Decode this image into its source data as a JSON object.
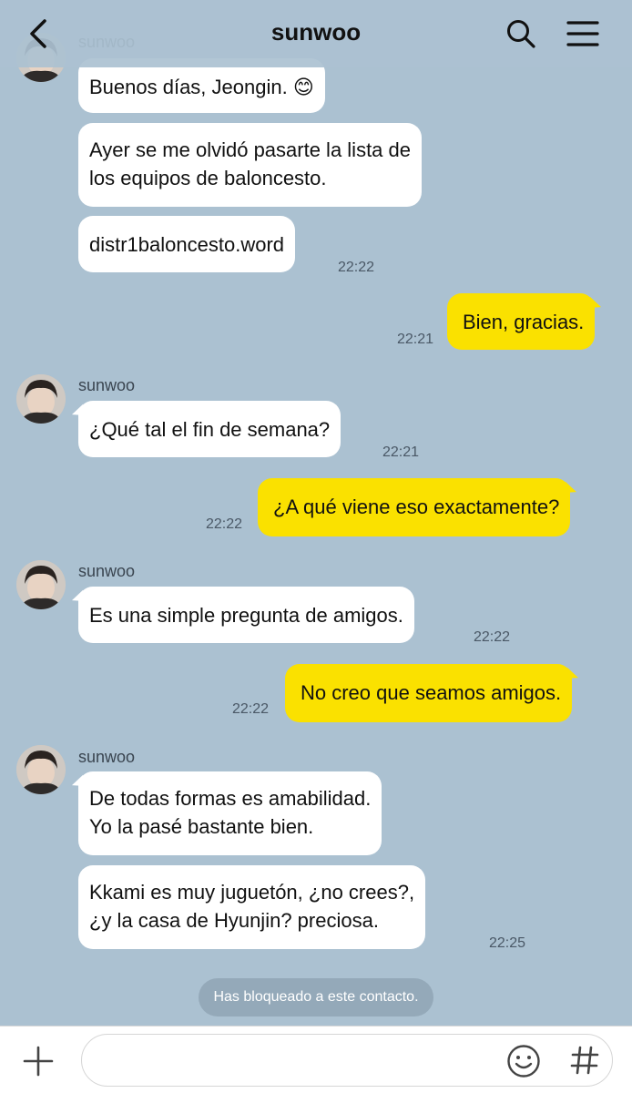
{
  "header": {
    "title": "sunwoo"
  },
  "messages": [
    {
      "from": "them",
      "text": "Buenos días, Jeongin. 😊"
    },
    {
      "from": "them",
      "text": "Ayer se me olvidó pasarte la lista de\nlos equipos de baloncesto."
    },
    {
      "from": "them",
      "text": "distr1baloncesto.word",
      "time": "22:22"
    },
    {
      "from": "me",
      "text": "Bien, gracias.",
      "time": "22:21"
    },
    {
      "from": "them",
      "sender": "sunwoo",
      "text": "¿Qué tal el fin de semana?",
      "time": "22:21"
    },
    {
      "from": "me",
      "text": "¿A qué viene eso exactamente?",
      "time": "22:22"
    },
    {
      "from": "them",
      "sender": "sunwoo",
      "text": "Es una simple pregunta de amigos.",
      "time": "22:22"
    },
    {
      "from": "me",
      "text": "No creo que seamos amigos.",
      "time": "22:22"
    },
    {
      "from": "them",
      "sender": "sunwoo",
      "text": "De todas formas es amabilidad.\nYo la pasé bastante bien."
    },
    {
      "from": "them",
      "text": "Kkami es muy juguetón, ¿no crees?,\n¿y la casa de Hyunjin? preciosa.",
      "time": "22:25"
    }
  ],
  "top_sender": "sunwoo",
  "notice": "Has bloqueado a este contacto.",
  "composer": {
    "placeholder": ""
  },
  "colors": {
    "background": "#abc1d1",
    "incoming_bubble": "#ffffff",
    "outgoing_bubble": "#fae100"
  },
  "icons": [
    "back-arrow-icon",
    "search-icon",
    "menu-icon",
    "plus-icon",
    "emoji-icon",
    "hashtag-icon"
  ]
}
